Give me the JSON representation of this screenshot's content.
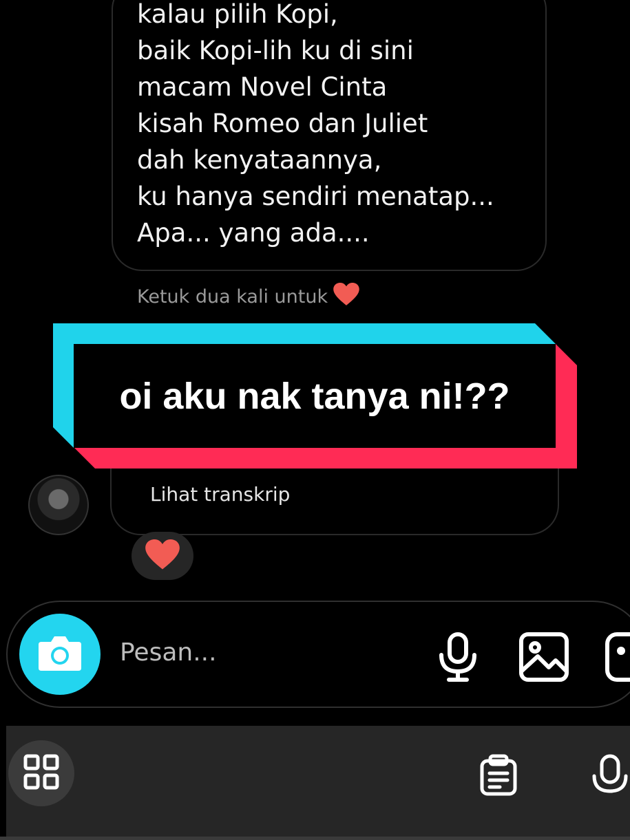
{
  "message": {
    "lines": [
      "kalau pilih Kopi,",
      "baik Kopi-lih ku di sini",
      "macam Novel Cinta",
      "kisah Romeo dan Juliet",
      "dah kenyataannya,",
      "ku hanya sendiri menatap...",
      "Apa... yang ada...."
    ],
    "hint_text": "Ketuk dua kali untuk",
    "hint_icon": "heart-icon"
  },
  "overlay": {
    "text": "oi aku nak tanya ni!??",
    "colors": {
      "cyan": "#20d3eb",
      "red": "#ff2b55"
    }
  },
  "voice_message": {
    "transcript_label": "Lihat transkrip",
    "reaction": "heart-icon"
  },
  "composer": {
    "placeholder": "Pesan...",
    "camera_color": "#23d5ef",
    "icons": [
      "camera-icon",
      "microphone-icon",
      "image-icon",
      "sticker-icon"
    ]
  },
  "keyboard_toolbar": {
    "icons": [
      "apps-grid-icon",
      "clipboard-icon",
      "microphone-icon"
    ]
  }
}
